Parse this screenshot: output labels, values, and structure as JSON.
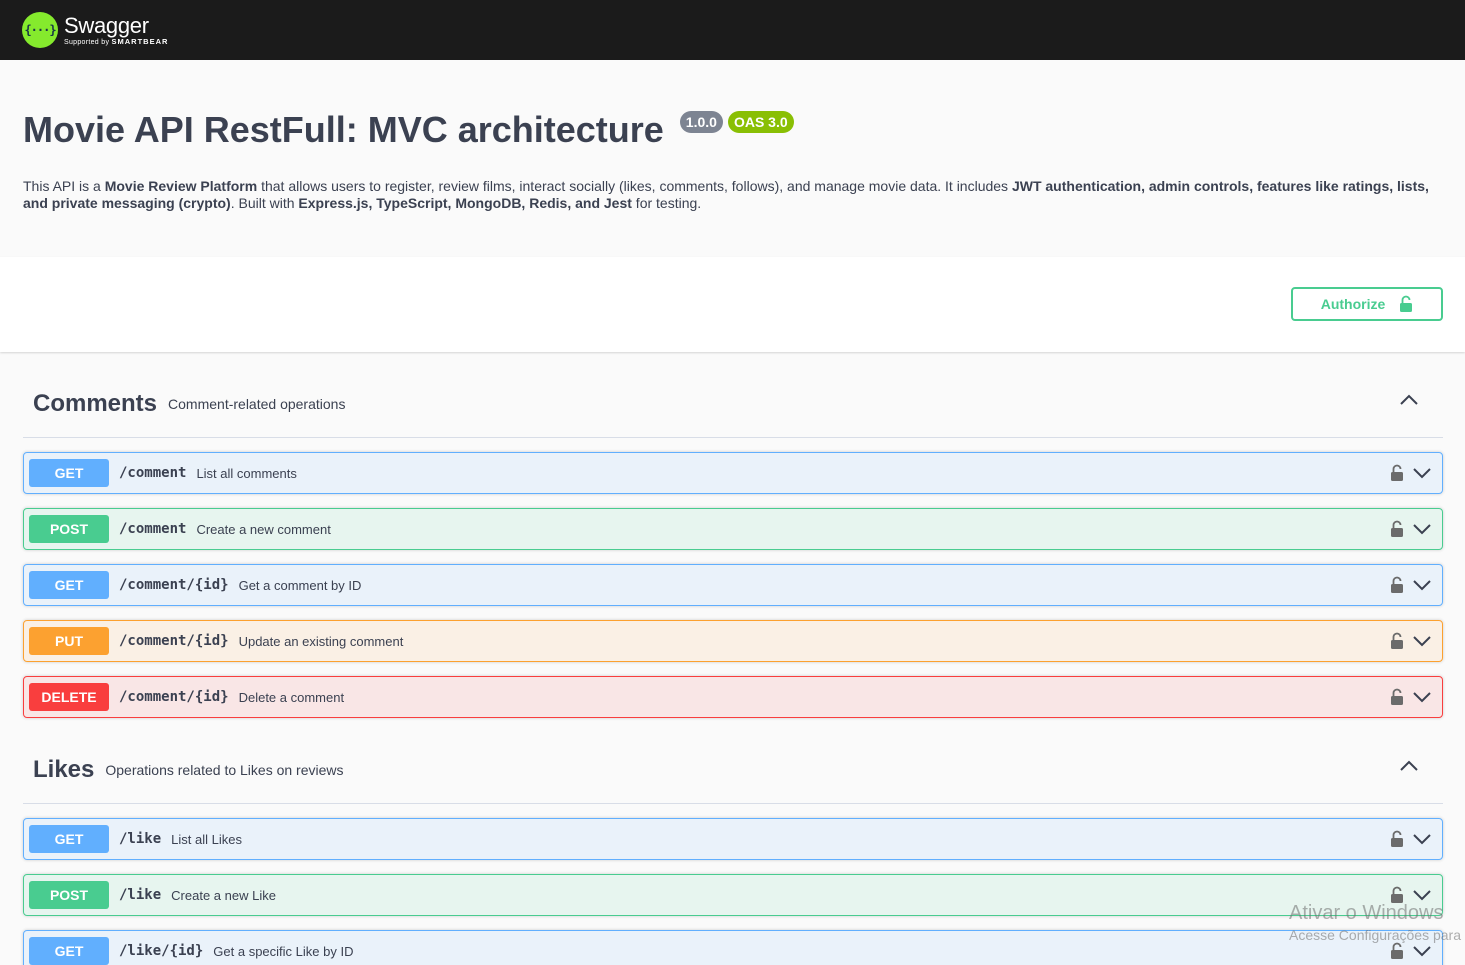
{
  "topbar": {
    "logo_mark": "{···}",
    "brand": "Swagger",
    "supported_by": "Supported by",
    "sponsor": "SMARTBEAR"
  },
  "info": {
    "title": "Movie API RestFull: MVC architecture",
    "version": "1.0.0",
    "oas": "OAS 3.0",
    "description": {
      "t1": "This API is a ",
      "b1": "Movie Review Platform",
      "t2": " that allows users to register, review films, interact socially (likes, comments, follows), and manage movie data. It includes ",
      "b2": "JWT authentication, admin controls, features like ratings, lists, and private messaging (crypto)",
      "t3": ". Built with ",
      "b3": "Express.js, TypeScript, MongoDB, Redis, and Jest",
      "t4": " for testing."
    }
  },
  "scheme": {
    "authorize_label": "Authorize"
  },
  "tags": [
    {
      "name": "Comments",
      "description": "Comment-related operations",
      "operations": [
        {
          "method": "GET",
          "path": "/comment",
          "summary": "List all comments"
        },
        {
          "method": "POST",
          "path": "/comment",
          "summary": "Create a new comment"
        },
        {
          "method": "GET",
          "path": "/comment/{id}",
          "summary": "Get a comment by ID"
        },
        {
          "method": "PUT",
          "path": "/comment/{id}",
          "summary": "Update an existing comment"
        },
        {
          "method": "DELETE",
          "path": "/comment/{id}",
          "summary": "Delete a comment"
        }
      ]
    },
    {
      "name": "Likes",
      "description": "Operations related to Likes on reviews",
      "operations": [
        {
          "method": "GET",
          "path": "/like",
          "summary": "List all Likes"
        },
        {
          "method": "POST",
          "path": "/like",
          "summary": "Create a new Like"
        },
        {
          "method": "GET",
          "path": "/like/{id}",
          "summary": "Get a specific Like by ID"
        }
      ]
    }
  ],
  "watermark": {
    "line1": "Ativar o Windows",
    "line2": "Acesse Configurações para"
  },
  "colors": {
    "get": "#61affe",
    "post": "#49cc90",
    "put": "#fca130",
    "delete": "#f93e3e",
    "topbar": "#1b1b1b",
    "logo_green": "#85ea2d"
  }
}
